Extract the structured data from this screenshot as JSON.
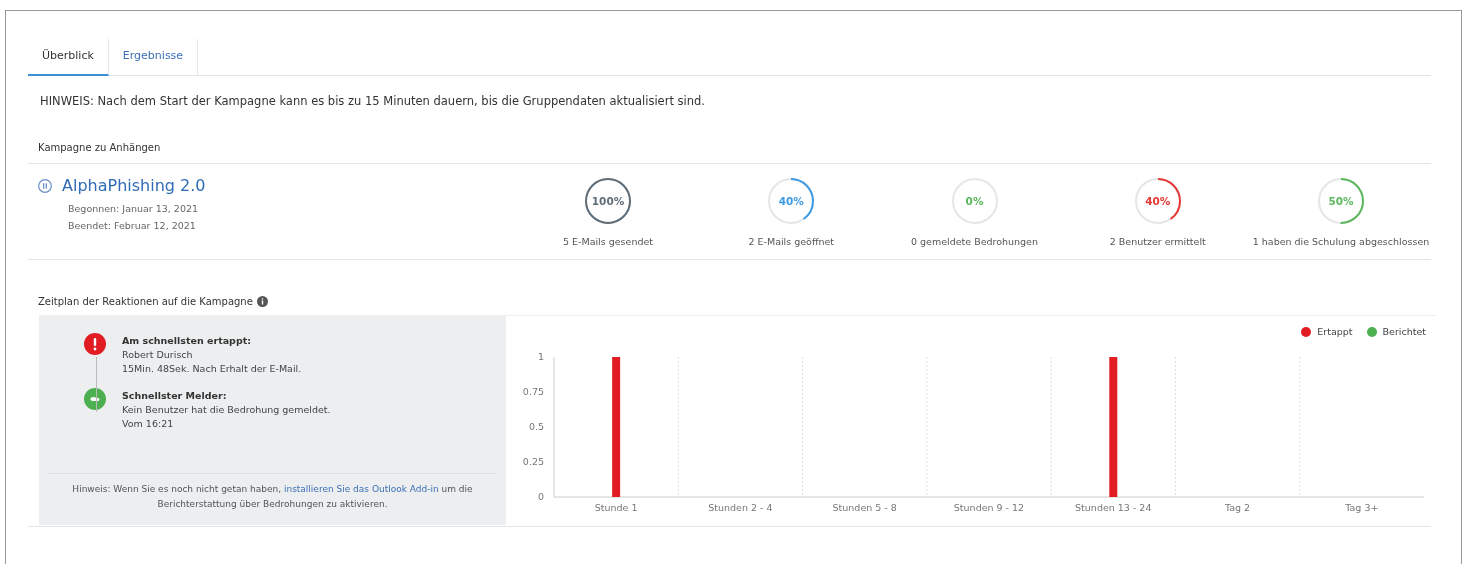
{
  "tabs": [
    {
      "label": "Überblick",
      "selected": true
    },
    {
      "label": "Ergebnisse",
      "selected": false
    }
  ],
  "notice": "HINWEIS: Nach dem Start der Kampagne kann es bis zu 15 Minuten dauern, bis die Gruppendaten aktualisiert sind.",
  "campaign_section": {
    "title": "Kampagne zu Anhängen",
    "campaign": {
      "name": "AlphaPhishing 2.0",
      "started": "Begonnen: Januar 13, 2021",
      "ended": "Beendet: Februar 12, 2021"
    },
    "stats": [
      {
        "percent": "100%",
        "label": "5 E-Mails gesendet",
        "color": "#5f6d78"
      },
      {
        "percent": "40%",
        "label": "2 E-Mails geöffnet",
        "color": "#3d9be3"
      },
      {
        "percent": "0%",
        "label": "0 gemeldete Bedrohungen",
        "color": "#5cb85c"
      },
      {
        "percent": "40%",
        "label": "2 Benutzer ermittelt",
        "color": "#e53935"
      },
      {
        "percent": "50%",
        "label": "1 haben die Schulung abgeschlossen",
        "color": "#5cb85c"
      }
    ]
  },
  "timeline_section": {
    "title": "Zeitplan der Reaktionen auf die Kampagne",
    "events": [
      {
        "kind": "caught",
        "title": "Am schnellsten ertappt:",
        "lines": [
          "Robert Durisch",
          "15Min. 48Sek. Nach Erhalt der E-Mail."
        ]
      },
      {
        "kind": "reporter",
        "title": "Schnellster Melder:",
        "lines": [
          "Kein Benutzer hat die Bedrohung gemeldet.",
          "Vom 16:21"
        ]
      }
    ],
    "hint": {
      "before": "Hinweis: Wenn Sie es noch nicht getan haben, ",
      "link": "installieren Sie das Outlook Add-in",
      "after": " um die Berichterstattung über Bedrohungen zu aktivieren."
    },
    "chart_data": {
      "type": "bar",
      "categories": [
        "Stunde 1",
        "Stunden 2 - 4",
        "Stunden 5 - 8",
        "Stunden 9 - 12",
        "Stunden 13 - 24",
        "Tag 2",
        "Tag 3+"
      ],
      "series": [
        {
          "name": "Ertappt",
          "color": "#e11d23",
          "values": [
            1,
            0,
            0,
            0,
            1,
            0,
            0
          ]
        },
        {
          "name": "Berichtet",
          "color": "#4caf50",
          "values": [
            0,
            0,
            0,
            0,
            0,
            0,
            0
          ]
        }
      ],
      "ylim": [
        0,
        1
      ],
      "yticks": [
        0,
        0.25,
        0.5,
        0.75,
        1
      ]
    }
  }
}
